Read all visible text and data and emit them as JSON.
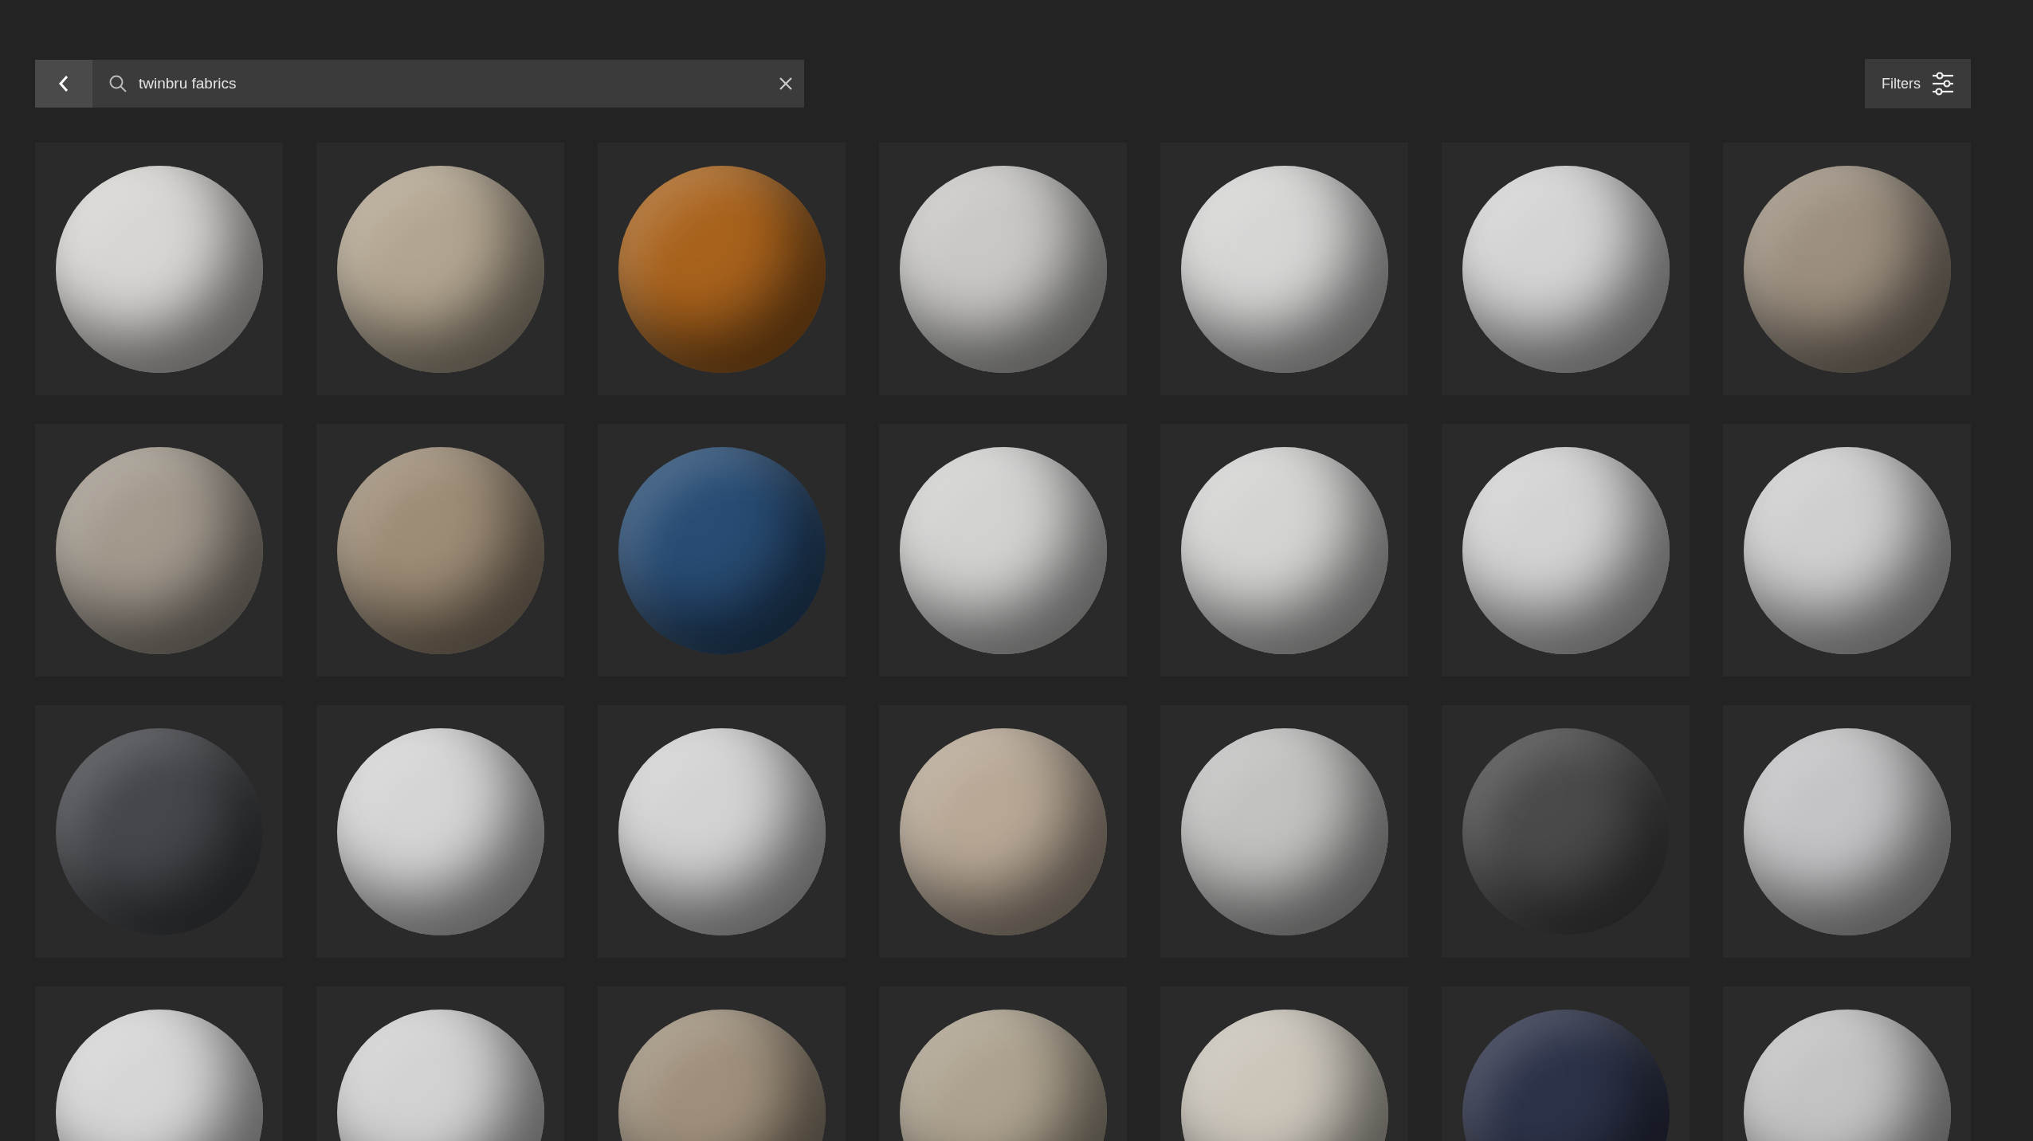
{
  "search": {
    "value": "twinbru fabrics"
  },
  "filters_button": {
    "label": "Filters"
  },
  "materials": [
    {
      "color": "#d8d6d2"
    },
    {
      "color": "#b3a691"
    },
    {
      "color": "#a8621c"
    },
    {
      "color": "#c9c8c6"
    },
    {
      "color": "#d6d6d5"
    },
    {
      "color": "#d4d4d4"
    },
    {
      "color": "#9c8f7f"
    },
    {
      "color": "#a39a8e"
    },
    {
      "color": "#9d8c76"
    },
    {
      "color": "#284c74"
    },
    {
      "color": "#d2d2d1"
    },
    {
      "color": "#d4d4d3"
    },
    {
      "color": "#d3d3d3"
    },
    {
      "color": "#cfcfcf"
    },
    {
      "color": "#45474c"
    },
    {
      "color": "#d5d5d5"
    },
    {
      "color": "#d3d3d3"
    },
    {
      "color": "#b8a896"
    },
    {
      "color": "#c2c2c1"
    },
    {
      "color": "#4a4a4a"
    },
    {
      "color": "#c4c4c6"
    },
    {
      "color": "#d6d6d6"
    },
    {
      "color": "#d2d2d2"
    },
    {
      "color": "#9f907c"
    },
    {
      "color": "#ada28f"
    },
    {
      "color": "#cbc5ba"
    },
    {
      "color": "#2c3248"
    },
    {
      "color": "#c3c3c3"
    }
  ]
}
